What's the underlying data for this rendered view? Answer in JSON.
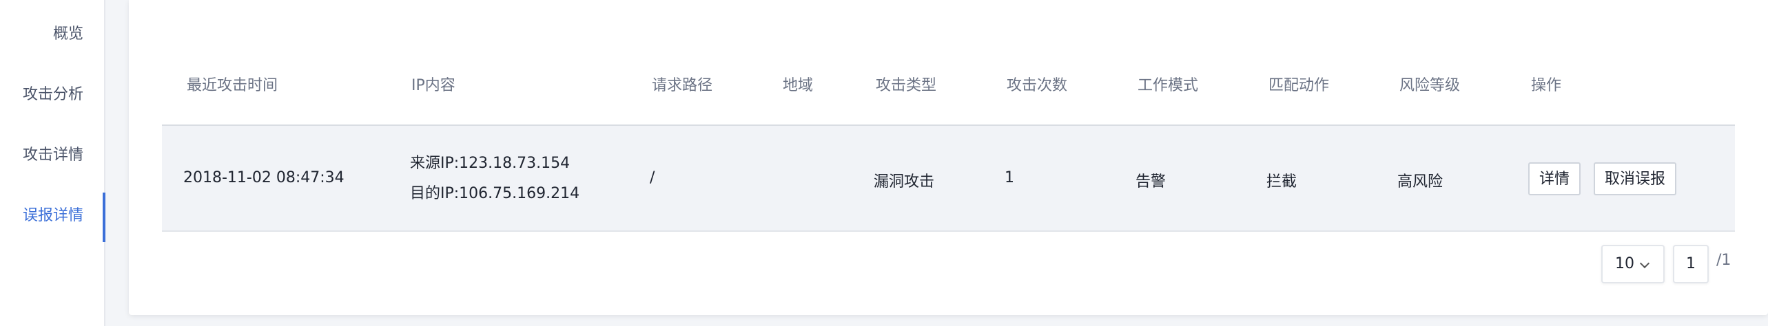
{
  "sidebar": {
    "items": [
      {
        "label": "概览",
        "active": false
      },
      {
        "label": "攻击分析",
        "active": false
      },
      {
        "label": "攻击详情",
        "active": false
      },
      {
        "label": "误报详情",
        "active": true
      }
    ]
  },
  "table": {
    "columns": [
      "最近攻击时间",
      "IP内容",
      "请求路径",
      "地域",
      "攻击类型",
      "攻击次数",
      "工作模式",
      "匹配动作",
      "风险等级",
      "操作"
    ],
    "rows": [
      {
        "time": "2018-11-02 08:47:34",
        "source_ip": "来源IP:123.18.73.154",
        "dest_ip": "目的IP:106.75.169.214",
        "path": "/",
        "region": "",
        "attack_type": "漏洞攻击",
        "count": "1",
        "mode": "告警",
        "action": "拦截",
        "risk": "高风险",
        "ops": {
          "detail_label": "详情",
          "cancel_label": "取消误报"
        }
      }
    ]
  },
  "pagination": {
    "page_size": "10",
    "current_page": "1",
    "total": "/1"
  },
  "colors": {
    "accent": "#3b6fd8",
    "row_bg": "#f1f3f7"
  }
}
